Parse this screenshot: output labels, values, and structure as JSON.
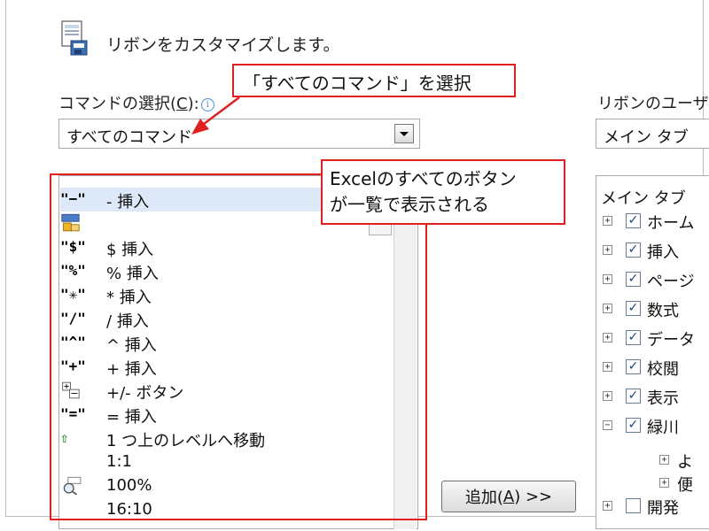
{
  "header": {
    "title": "リボンをカスタマイズします。",
    "icon": "document-ribbon-icon"
  },
  "commands": {
    "label_prefix": "コマンドの選択(",
    "label_accel": "C",
    "label_suffix": "):",
    "info_icon": "i",
    "selected": "すべてのコマンド"
  },
  "ribbon": {
    "label": "リボンのユーザー",
    "selected": "メイン タブ"
  },
  "command_list": [
    {
      "icon": "\"−\"",
      "label": "- 挿入"
    },
    {
      "icon": "",
      "label": ""
    },
    {
      "icon": "\"$\"",
      "label": "$ 挿入"
    },
    {
      "icon": "\"%\"",
      "label": "% 挿入"
    },
    {
      "icon": "\"✳\"",
      "label": "* 挿入"
    },
    {
      "icon": "\"/\"",
      "label": "/ 挿入"
    },
    {
      "icon": "\"^\"",
      "label": "^ 挿入"
    },
    {
      "icon": "\"+\"",
      "label": "+ 挿入"
    },
    {
      "icon": "",
      "label": "+/- ボタン"
    },
    {
      "icon": "\"=\"",
      "label": "= 挿入"
    },
    {
      "icon": "⇧",
      "label": "1 つ上のレベルへ移動"
    },
    {
      "icon": "",
      "label": "1:1"
    },
    {
      "icon": "",
      "label": "100%"
    },
    {
      "icon": "",
      "label": "16:10"
    }
  ],
  "add_button": {
    "label_prefix": "追加(",
    "accel": "A",
    "label_suffix": ") >>"
  },
  "tree": {
    "header": "メイン タブ",
    "items": [
      {
        "toggle": "+",
        "checked": true,
        "label": "ホーム"
      },
      {
        "toggle": "+",
        "checked": true,
        "label": "挿入"
      },
      {
        "toggle": "+",
        "checked": true,
        "label": "ページ"
      },
      {
        "toggle": "+",
        "checked": true,
        "label": "数式"
      },
      {
        "toggle": "+",
        "checked": true,
        "label": "データ"
      },
      {
        "toggle": "+",
        "checked": true,
        "label": "校閲"
      },
      {
        "toggle": "+",
        "checked": true,
        "label": "表示"
      },
      {
        "toggle": "−",
        "checked": true,
        "label": "緑川"
      }
    ],
    "subitems": [
      {
        "toggle": "+",
        "label": "よ"
      },
      {
        "toggle": "+",
        "label": "便"
      }
    ],
    "last_item": {
      "toggle": "+",
      "checked": false,
      "label": "開発"
    }
  },
  "annotations": {
    "callout1": "「すべてのコマンド」を選択",
    "callout2_line1": "Excelのすべてのボタン",
    "callout2_line2": "が一覧で表示される"
  },
  "colors": {
    "annotation_red": "#e02020",
    "selection_blue": "#dde9f9",
    "checkbox_check": "#1b3f8b"
  }
}
